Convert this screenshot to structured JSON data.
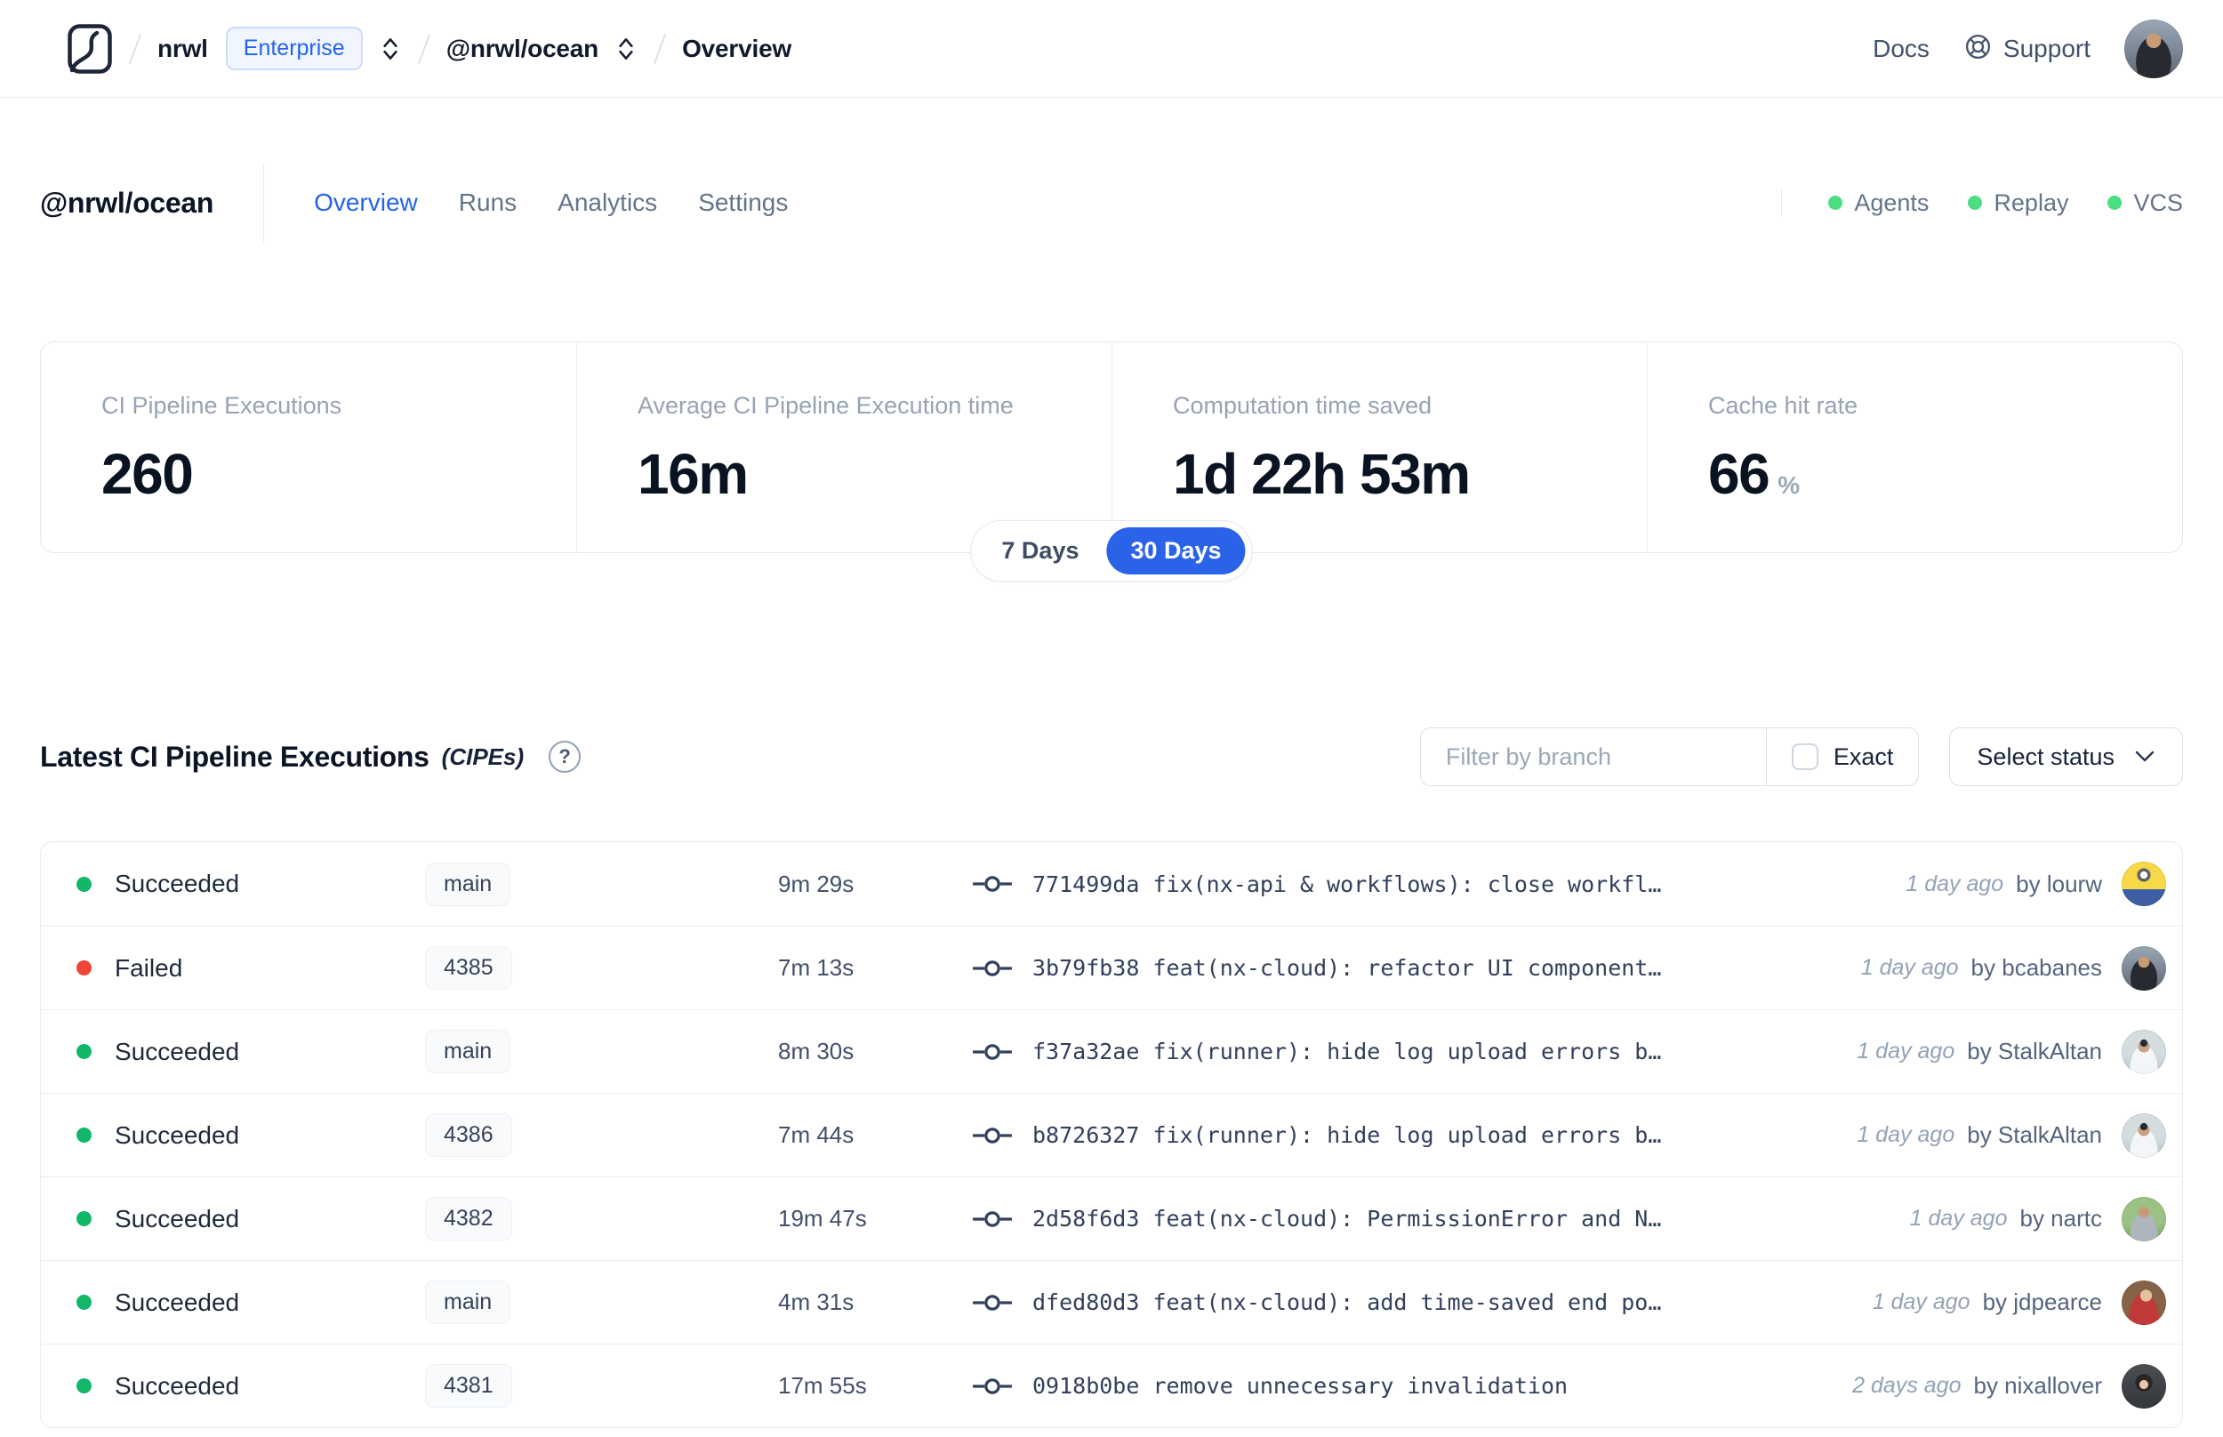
{
  "icons": {
    "help_glyph": "?"
  },
  "colors": {
    "accent": "#2563eb",
    "success": "#12b76a",
    "failed": "#f04438",
    "indicator": "#4ade80"
  },
  "topbar": {
    "org": "nrwl",
    "org_badge": "Enterprise",
    "workspace": "@nrwl/ocean",
    "page": "Overview",
    "docs_label": "Docs",
    "support_label": "Support"
  },
  "workspace_header": {
    "title": "@nrwl/ocean",
    "tabs": [
      {
        "label": "Overview",
        "active": true
      },
      {
        "label": "Runs",
        "active": false
      },
      {
        "label": "Analytics",
        "active": false
      },
      {
        "label": "Settings",
        "active": false
      }
    ],
    "status_indicators": [
      {
        "label": "Agents"
      },
      {
        "label": "Replay"
      },
      {
        "label": "VCS"
      }
    ]
  },
  "stats": {
    "cards": [
      {
        "label": "CI Pipeline Executions",
        "value": "260",
        "suffix": ""
      },
      {
        "label": "Average CI Pipeline Execution time",
        "value": "16m",
        "suffix": ""
      },
      {
        "label": "Computation time saved",
        "value": "1d 22h 53m",
        "suffix": ""
      },
      {
        "label": "Cache hit rate",
        "value": "66",
        "suffix": "%"
      }
    ],
    "range_toggle": {
      "options": [
        "7 Days",
        "30 Days"
      ],
      "selected": "30 Days"
    }
  },
  "cipe_section": {
    "title": "Latest CI Pipeline Executions",
    "title_suffix": "(CIPEs)",
    "filter": {
      "branch_placeholder": "Filter by branch",
      "exact_label": "Exact",
      "status_label": "Select status"
    },
    "rows": [
      {
        "status": "Succeeded",
        "status_color": "green",
        "branch": "main",
        "duration": "9m 29s",
        "commit": "771499da fix(nx-api & workflows): close workfl…",
        "time": "1 day ago",
        "author": "by lourw",
        "avatar": "minion"
      },
      {
        "status": "Failed",
        "status_color": "red",
        "branch": "4385",
        "duration": "7m 13s",
        "commit": "3b79fb38 feat(nx-cloud): refactor UI component…",
        "time": "1 day ago",
        "author": "by bcabanes",
        "avatar": "hooded"
      },
      {
        "status": "Succeeded",
        "status_color": "green",
        "branch": "main",
        "duration": "8m 30s",
        "commit": "f37a32ae fix(runner): hide log upload errors b…",
        "time": "1 day ago",
        "author": "by StalkAltan",
        "avatar": "sunglasses"
      },
      {
        "status": "Succeeded",
        "status_color": "green",
        "branch": "4386",
        "duration": "7m 44s",
        "commit": "b8726327 fix(runner): hide log upload errors b…",
        "time": "1 day ago",
        "author": "by StalkAltan",
        "avatar": "sunglasses"
      },
      {
        "status": "Succeeded",
        "status_color": "green",
        "branch": "4382",
        "duration": "19m 47s",
        "commit": "2d58f6d3 feat(nx-cloud): PermissionError and N…",
        "time": "1 day ago",
        "author": "by nartc",
        "avatar": "outdoor"
      },
      {
        "status": "Succeeded",
        "status_color": "green",
        "branch": "main",
        "duration": "4m 31s",
        "commit": "dfed80d3 feat(nx-cloud): add time-saved end po…",
        "time": "1 day ago",
        "author": "by jdpearce",
        "avatar": "redshirt"
      },
      {
        "status": "Succeeded",
        "status_color": "green",
        "branch": "4381",
        "duration": "17m 55s",
        "commit": "0918b0be remove unnecessary invalidation",
        "time": "2 days ago",
        "author": "by nixallover",
        "avatar": "darkhair"
      }
    ]
  }
}
